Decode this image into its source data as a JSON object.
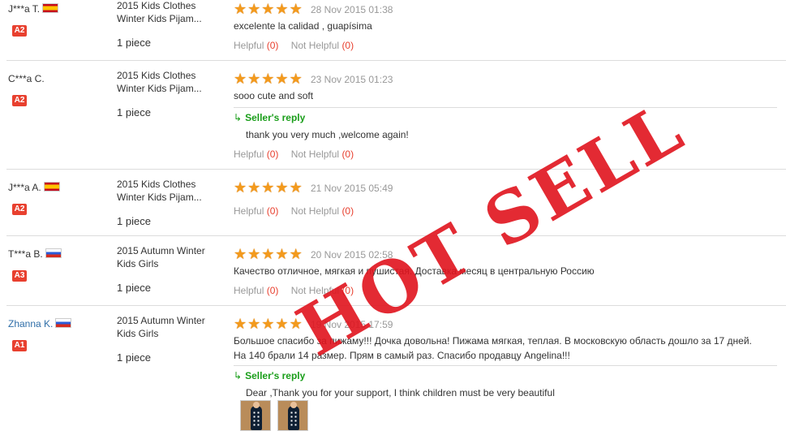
{
  "helpful_label": "Helpful",
  "not_helpful_label": "Not Helpful",
  "reply_label": "Seller's reply",
  "watermark": "HOT SELL",
  "reviews": [
    {
      "buyer": "J***a T.",
      "flag": "es",
      "level": "A2",
      "product": [
        "2015 Kids Clothes",
        "Winter Kids Pijam..."
      ],
      "qty": "1 piece",
      "rating": 5,
      "date": "28 Nov 2015 01:38",
      "comment": "excelente la calidad , guapísima",
      "helpful": "(0)",
      "not_helpful": "(0)"
    },
    {
      "buyer": "C***a C.",
      "level": "A2",
      "product": [
        "2015 Kids Clothes",
        "Winter Kids Pijam..."
      ],
      "qty": "1 piece",
      "rating": 5,
      "date": "23 Nov 2015 01:23",
      "comment": "sooo cute and soft",
      "reply": "thank you very much ,welcome again!",
      "helpful": "(0)",
      "not_helpful": "(0)"
    },
    {
      "buyer": "J***a A.",
      "flag": "es",
      "level": "A2",
      "product": [
        "2015 Kids Clothes",
        "Winter Kids Pijam..."
      ],
      "qty": "1 piece",
      "rating": 5,
      "date": "21 Nov 2015 05:49",
      "helpful": "(0)",
      "not_helpful": "(0)"
    },
    {
      "buyer": "T***a B.",
      "flag": "ru",
      "level": "A3",
      "product": [
        "2015 Autumn Winter",
        "Kids Girls"
      ],
      "qty": "1 piece",
      "rating": 5,
      "date": "20 Nov 2015 02:58",
      "comment": "Качество отличное, мягкая и пушистая. Доставка месяц в центральную Россию",
      "helpful": "(0)",
      "not_helpful": "(0)"
    },
    {
      "buyer": "Zhanna K.",
      "flag": "ru",
      "level": "A1",
      "product": [
        "2015 Autumn Winter",
        "Kids Girls"
      ],
      "qty": "1 piece",
      "rating": 5,
      "date": "19 Nov 2015 17:59",
      "comment": "Большое спасибо за пижаму!!! Дочка довольна! Пижама мягкая, теплая. В московскую область дошло за 17 дней.",
      "comment2": "На 140 брали 14 размер. Прям в самый раз. Спасибо продавцу Angelina!!!",
      "reply": "Dear ,Thank you for your support, I think children must be very beautiful"
    }
  ]
}
